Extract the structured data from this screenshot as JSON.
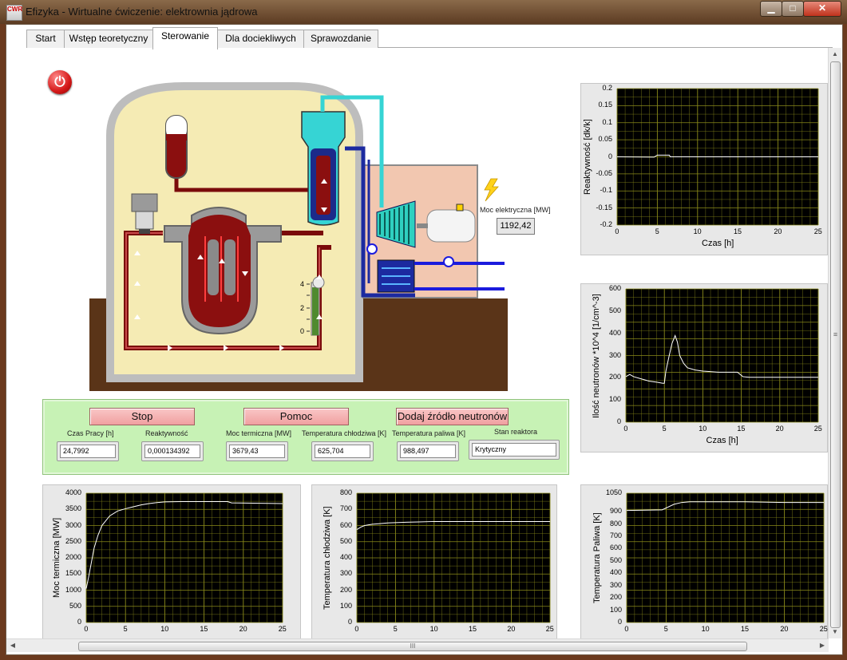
{
  "window": {
    "title": "Efizyka - Wirtualne ćwiczenie: elektrownia jądrowa",
    "icon_text": "CWR",
    "minimize_glyph": "▁",
    "maximize_glyph": "□",
    "close_glyph": "✕"
  },
  "tabs": [
    {
      "label": "Start",
      "active": false
    },
    {
      "label": "Wstęp teoretyczny",
      "active": false
    },
    {
      "label": "Sterowanie",
      "active": true
    },
    {
      "label": "Dla dociekliwych",
      "active": false
    },
    {
      "label": "Sprawozdanie",
      "active": false
    }
  ],
  "scroll": {
    "hthumb_glyph": "III",
    "up": "▲",
    "down": "▼",
    "left": "◀",
    "right": "▶",
    "vthumb_glyph": "≡"
  },
  "icons": {
    "power": "power-icon",
    "lightning": "lightning-icon",
    "pump": "pump-icon"
  },
  "diagram": {
    "power_glyph": "⏻",
    "generator_label": "Moc elektryczna [MW]",
    "generator_value": "1192,42",
    "gauge_ticks": [
      "4",
      "2",
      "0"
    ]
  },
  "controls": {
    "buttons": {
      "stop": "Stop",
      "help": "Pomoc",
      "add_source": "Dodaj źródło neutronów"
    },
    "fields": [
      {
        "label": "Czas Pracy [h]",
        "value": "24,7992"
      },
      {
        "label": "Reaktywność",
        "value": "0,000134392"
      },
      {
        "label": "Moc termiczna [MW]",
        "value": "3679,43"
      },
      {
        "label": "Temperatura chłodziwa [K]",
        "value": "625,704"
      },
      {
        "label": "Temperatura  paliwa [K]",
        "value": "988,497"
      },
      {
        "label": "Stan reaktora",
        "value": "Krytyczny"
      }
    ]
  },
  "colors": {
    "plot_bg": "#000000",
    "grid": "#8a8a1a",
    "trace": "#ffffff",
    "panel": "#c7f2b5",
    "button": "#f2a8a8"
  },
  "chart_data": [
    {
      "type": "line",
      "id": "reactivity",
      "xlabel": "Czas [h]",
      "ylabel": "Reaktywność  [dk/k]",
      "xlim": [
        0,
        25
      ],
      "ylim": [
        -0.2,
        0.2
      ],
      "grid": true,
      "xticks": [
        "0",
        "5",
        "10",
        "15",
        "20",
        "25"
      ],
      "yticks": [
        "0.2",
        "0.15",
        "0.1",
        "0.05",
        "0",
        "-0.05",
        "-0.1",
        "-0.15",
        "-0.2"
      ],
      "series": [
        {
          "x": [
            0,
            4.6,
            5.0,
            6.5,
            6.6,
            25
          ],
          "y": [
            0,
            -0.001,
            0.005,
            0.005,
            0.0,
            0.0
          ]
        }
      ]
    },
    {
      "type": "line",
      "id": "neutrons",
      "xlabel": "Czas [h]",
      "ylabel": "Ilość neutronów *10^4  [1/cm^-3]",
      "xlim": [
        0,
        25
      ],
      "ylim": [
        0,
        600
      ],
      "grid": true,
      "xticks": [
        "0",
        "5",
        "10",
        "15",
        "20",
        "25"
      ],
      "yticks": [
        "600",
        "500",
        "400",
        "300",
        "200",
        "100",
        "0"
      ],
      "series": [
        {
          "x": [
            0,
            0.5,
            1,
            2,
            3,
            4,
            4.8,
            5.0,
            5.2,
            5.6,
            6,
            6.4,
            6.7,
            7.0,
            7.5,
            8,
            9,
            10,
            12,
            14.5,
            15.2,
            16,
            25
          ],
          "y": [
            205,
            215,
            205,
            195,
            185,
            180,
            175,
            175,
            230,
            295,
            355,
            390,
            360,
            300,
            265,
            245,
            235,
            230,
            225,
            225,
            205,
            202,
            202
          ]
        }
      ]
    },
    {
      "type": "line",
      "id": "thermal-power",
      "xlabel": "",
      "ylabel": "Moc termiczna  [MW]",
      "xlim": [
        0,
        25
      ],
      "ylim": [
        0,
        4000
      ],
      "grid": true,
      "xticks": [
        "0",
        "5",
        "10",
        "15",
        "20",
        "25"
      ],
      "yticks": [
        "4000",
        "3500",
        "3000",
        "2500",
        "2000",
        "1500",
        "1000",
        "500",
        "0"
      ],
      "series": [
        {
          "x": [
            0,
            0.3,
            1,
            1.5,
            2,
            3,
            4,
            5,
            6,
            7,
            8,
            9,
            10,
            12,
            18,
            18.5,
            25
          ],
          "y": [
            1050,
            1400,
            2300,
            2700,
            3000,
            3300,
            3450,
            3520,
            3580,
            3640,
            3680,
            3710,
            3730,
            3740,
            3740,
            3700,
            3680
          ]
        }
      ]
    },
    {
      "type": "line",
      "id": "coolant-temp",
      "xlabel": "",
      "ylabel": "Temperatura chłodziwa  [K]",
      "xlim": [
        0,
        25
      ],
      "ylim": [
        0,
        800
      ],
      "grid": true,
      "xticks": [
        "0",
        "5",
        "10",
        "15",
        "20",
        "25"
      ],
      "yticks": [
        "800",
        "700",
        "600",
        "500",
        "400",
        "300",
        "200",
        "100",
        "0"
      ],
      "series": [
        {
          "x": [
            0,
            0.5,
            1,
            2,
            3,
            4,
            6,
            8,
            10,
            25
          ],
          "y": [
            575,
            590,
            600,
            608,
            612,
            616,
            620,
            622,
            625,
            625
          ]
        }
      ]
    },
    {
      "type": "line",
      "id": "fuel-temp",
      "xlabel": "",
      "ylabel": "Temperatura Paliwa  [K]",
      "xlim": [
        0,
        25
      ],
      "ylim": [
        0,
        1050
      ],
      "grid": true,
      "xticks": [
        "0",
        "5",
        "10",
        "15",
        "20",
        "25"
      ],
      "yticks": [
        "1050",
        "900",
        "800",
        "700",
        "600",
        "500",
        "400",
        "300",
        "200",
        "100",
        "0"
      ],
      "series": [
        {
          "x": [
            0,
            4.5,
            5.0,
            6.0,
            7.0,
            8.0,
            10,
            15,
            20,
            25
          ],
          "y": [
            910,
            915,
            930,
            960,
            975,
            980,
            980,
            980,
            975,
            975
          ]
        }
      ]
    }
  ]
}
